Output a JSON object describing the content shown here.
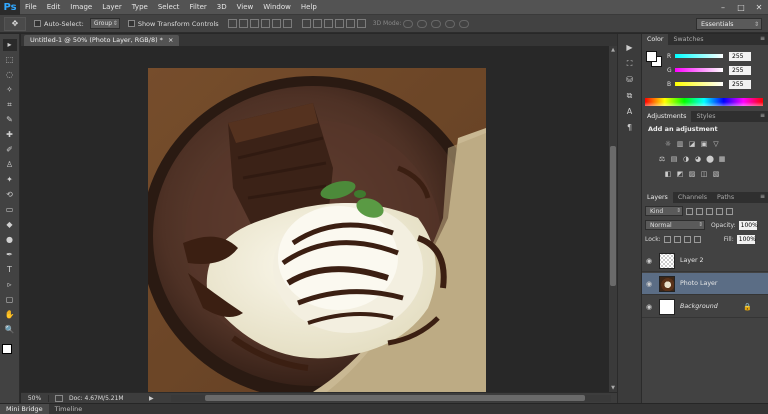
{
  "app": {
    "logo": "Ps"
  },
  "menu": [
    "File",
    "Edit",
    "Image",
    "Layer",
    "Type",
    "Select",
    "Filter",
    "3D",
    "View",
    "Window",
    "Help"
  ],
  "window_controls": {
    "minimize": "–",
    "maximize": "□",
    "close": "✕"
  },
  "options": {
    "tool_glyph": "✥",
    "auto_select_label": "Auto-Select:",
    "auto_select_value": "Group",
    "show_transform_label": "Show Transform Controls",
    "three_d_mode_label": "3D Mode:",
    "workspace": "Essentials"
  },
  "document": {
    "tab_title": "Untitled-1 @ 50% (Photo Layer, RGB/8) *",
    "tab_close": "×",
    "zoom": "50%",
    "doc_size": "Doc: 4.67M/5.21M",
    "status_arrow": "▶"
  },
  "bottom_tabs": [
    "Mini Bridge",
    "Timeline"
  ],
  "tools": [
    "▸",
    "⬚",
    "◌",
    "✧",
    "⌗",
    "✎",
    "✚",
    "✐",
    "♙",
    "✦",
    "⟲",
    "▭",
    "◆",
    "●",
    "✒",
    "T",
    "▹",
    "▢",
    "✋",
    "🔍"
  ],
  "color_panel": {
    "tabs": [
      "Color",
      "Swatches"
    ],
    "channels": [
      {
        "letter": "R",
        "value": "255",
        "color": "#ff3b3b"
      },
      {
        "letter": "G",
        "value": "255",
        "color": "#ff40ff"
      },
      {
        "letter": "B",
        "value": "255",
        "color": "#f0e530"
      }
    ],
    "menu_glyph": "≡"
  },
  "adjustments_panel": {
    "tabs": [
      "Adjustments",
      "Styles"
    ],
    "title": "Add an adjustment",
    "row1": [
      "☼",
      "▥",
      "◪",
      "▣",
      "▽"
    ],
    "row2": [
      "⚖",
      "▤",
      "◑",
      "◕",
      "⬤",
      "▦"
    ],
    "row3": [
      "◧",
      "◩",
      "▨",
      "◫",
      "▧"
    ]
  },
  "layers_panel": {
    "tabs": [
      "Layers",
      "Channels",
      "Paths"
    ],
    "kind_label": "Kind",
    "blend_mode": "Normal",
    "opacity_label": "Opacity:",
    "opacity_value": "100%",
    "lock_label": "Lock:",
    "fill_label": "Fill:",
    "fill_value": "100%",
    "layers": [
      {
        "name": "Layer 2",
        "thumb": "transparent",
        "visible": true,
        "selected": false,
        "italic": false
      },
      {
        "name": "Photo Layer",
        "thumb": "photo",
        "visible": true,
        "selected": true,
        "italic": false
      },
      {
        "name": "Background",
        "thumb": "white",
        "visible": true,
        "selected": false,
        "italic": true,
        "locked": true
      }
    ],
    "footer_icons": [
      "∞",
      "fx",
      "◐",
      "◍",
      "▭",
      "▤",
      "🗑"
    ]
  },
  "dock_icons": [
    "▶",
    "⛶",
    "⛁",
    "⧉",
    "A",
    "¶"
  ]
}
